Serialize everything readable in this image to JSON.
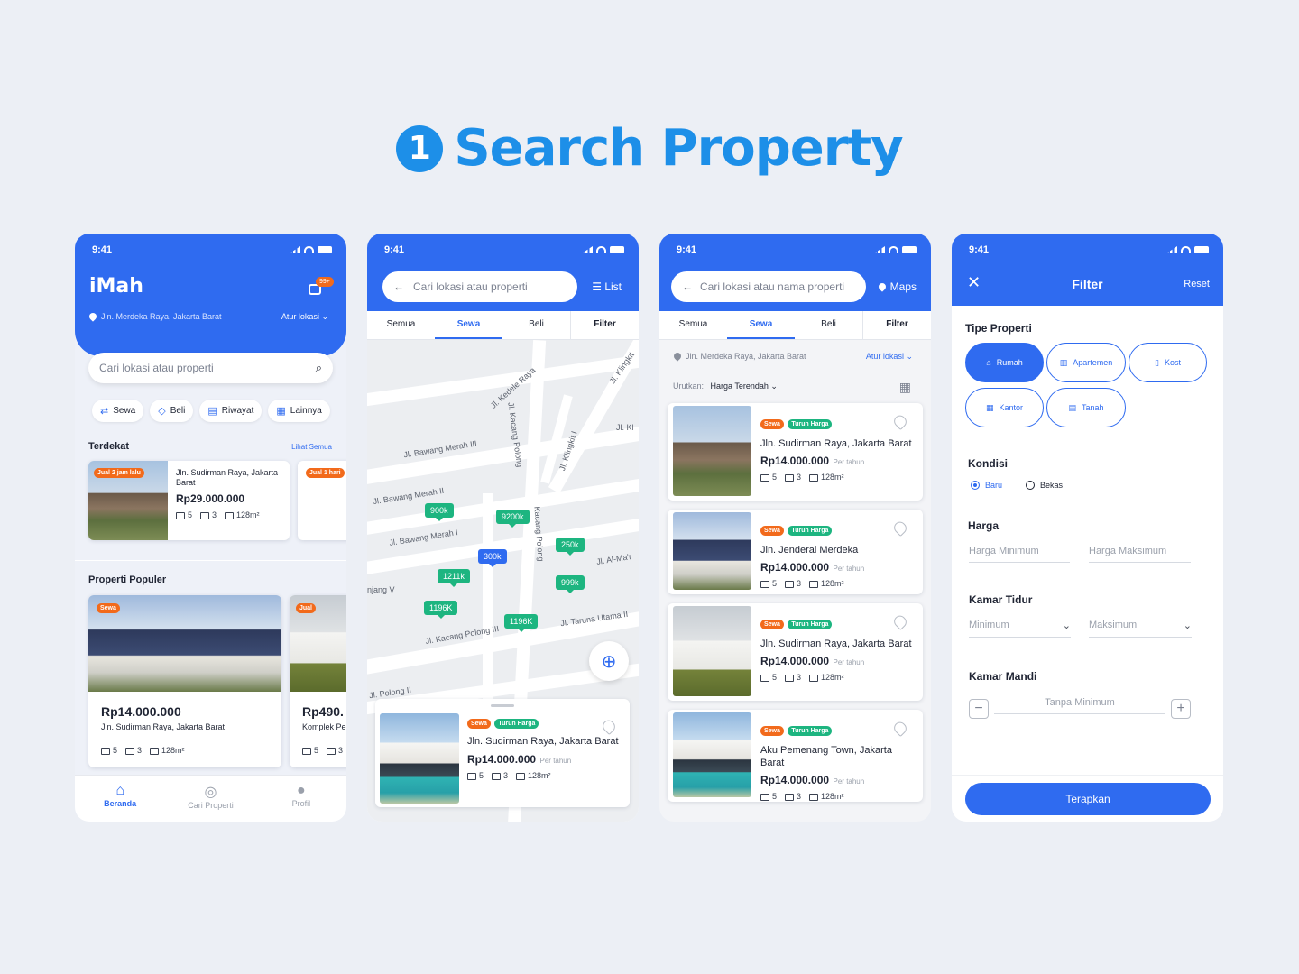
{
  "header": {
    "step": "1",
    "title": "Search Property"
  },
  "status_time": "9:41",
  "home": {
    "app_name": "iMah",
    "notif_badge": "99+",
    "location": "Jln. Merdeka Raya, Jakarta Barat",
    "location_action": "Atur lokasi",
    "search_placeholder": "Cari lokasi atau properti",
    "chips": [
      "Sewa",
      "Beli",
      "Riwayat",
      "Lainnya"
    ],
    "nearby_title": "Terdekat",
    "see_all": "Lihat Semua",
    "nearby_card": {
      "tag": "Jual 2 jam lalu",
      "address": "Jln. Sudirman Raya, Jakarta Barat",
      "price": "Rp29.000.000",
      "beds": "5",
      "baths": "3",
      "area": "128m²"
    },
    "nearby_card2_tag": "Jual 1 hari",
    "popular_title": "Properti Populer",
    "popular_card": {
      "tag": "Sewa",
      "price": "Rp14.000.000",
      "address": "Jln. Sudirman Raya, Jakarta Barat",
      "beds": "5",
      "baths": "3",
      "area": "128m²"
    },
    "popular_card2": {
      "tag": "Jual",
      "price": "Rp490.",
      "address": "Komplek Pe",
      "beds": "5",
      "baths": "3"
    },
    "nav": [
      "Beranda",
      "Cari Properti",
      "Profil"
    ]
  },
  "map": {
    "search_placeholder": "Cari lokasi atau properti",
    "list_label": "List",
    "tabs": [
      "Semua",
      "Sewa",
      "Beli",
      "Filter"
    ],
    "streets": [
      "Jl. Kedele Raya",
      "Jl. Klingkit",
      "Jl. Kl",
      "Jl. Bawang Merah III",
      "Jl. Kacang Polong",
      "Jl. Klingkit I",
      "Jl. Bawang Merah II",
      "Jl. Bawang Merah I",
      "Jl. Al-Ma'r",
      "njang V",
      "Jl. Kacang Polong III",
      "Jl. Taruna Utama II",
      "Jl. Polong II",
      "Kacang Polong"
    ],
    "markers": [
      "900k",
      "9200k",
      "300k",
      "250k",
      "1211k",
      "999k",
      "1196K",
      "1196K"
    ],
    "card": {
      "tag1": "Sewa",
      "tag2": "Turun Harga",
      "address": "Jln. Sudirman Raya, Jakarta Barat",
      "price": "Rp14.000.000",
      "per": "Per tahun",
      "beds": "5",
      "baths": "3",
      "area": "128m²"
    }
  },
  "list": {
    "search_placeholder": "Cari lokasi atau nama properti",
    "maps_label": "Maps",
    "tabs": [
      "Semua",
      "Sewa",
      "Beli",
      "Filter"
    ],
    "location": "Jln. Merdeka Raya, Jakarta Barat",
    "location_action": "Atur lokasi",
    "sort_label": "Urutkan:",
    "sort_value": "Harga Terendah",
    "items": [
      {
        "tag1": "Sewa",
        "tag2": "Turun Harga",
        "address": "Jln. Sudirman Raya, Jakarta Barat",
        "price": "Rp14.000.000",
        "per": "Per tahun",
        "beds": "5",
        "baths": "3",
        "area": "128m²"
      },
      {
        "tag1": "Sewa",
        "tag2": "Turun Harga",
        "address": "Jln. Jenderal Merdeka",
        "price": "Rp14.000.000",
        "per": "Per tahun",
        "beds": "5",
        "baths": "3",
        "area": "128m²"
      },
      {
        "tag1": "Sewa",
        "tag2": "Turun Harga",
        "address": "Jln. Sudirman Raya, Jakarta Barat",
        "price": "Rp14.000.000",
        "per": "Per tahun",
        "beds": "5",
        "baths": "3",
        "area": "128m²"
      },
      {
        "tag1": "Sewa",
        "tag2": "Turun Harga",
        "address": "Aku Pemenang Town, Jakarta Barat",
        "price": "Rp14.000.000",
        "per": "Per tahun",
        "beds": "5",
        "baths": "3",
        "area": "128m²"
      }
    ]
  },
  "filter": {
    "title": "Filter",
    "reset": "Reset",
    "type_label": "Tipe Properti",
    "types": [
      "Rumah",
      "Apartemen",
      "Kost",
      "Kantor",
      "Tanah"
    ],
    "condition_label": "Kondisi",
    "conditions": [
      "Baru",
      "Bekas"
    ],
    "price_label": "Harga",
    "price_min": "Harga Minimum",
    "price_max": "Harga Maksimum",
    "bedroom_label": "Kamar Tidur",
    "bed_min": "Minimum",
    "bed_max": "Maksimum",
    "bathroom_label": "Kamar Mandi",
    "bath_placeholder": "Tanpa Minimum",
    "apply": "Terapkan"
  },
  "colors": {
    "primary": "#2f6bf0",
    "accent": "#f26a1b",
    "green": "#1db580",
    "title_blue": "#1d8fe8"
  }
}
